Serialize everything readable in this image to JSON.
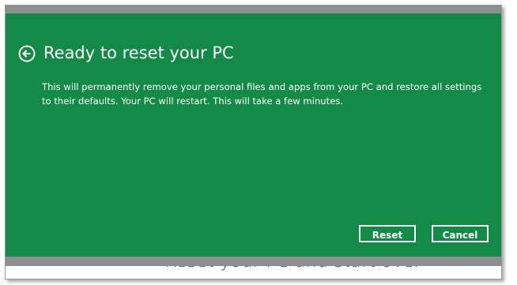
{
  "dialog": {
    "title": "Ready to reset your PC",
    "message": "This will permanently remove your personal files and apps from your PC and restore all settings to their defaults. Your PC will restart. This will take a few minutes.",
    "buttons": {
      "reset_label": "Reset",
      "cancel_label": "Cancel"
    },
    "back_icon": "back-arrow-circle-icon"
  },
  "background": {
    "page_heading": "Reset your PC and start over"
  },
  "colors": {
    "dialog_background": "#138a47",
    "text": "#ffffff",
    "strip": "#8e8e8e"
  }
}
